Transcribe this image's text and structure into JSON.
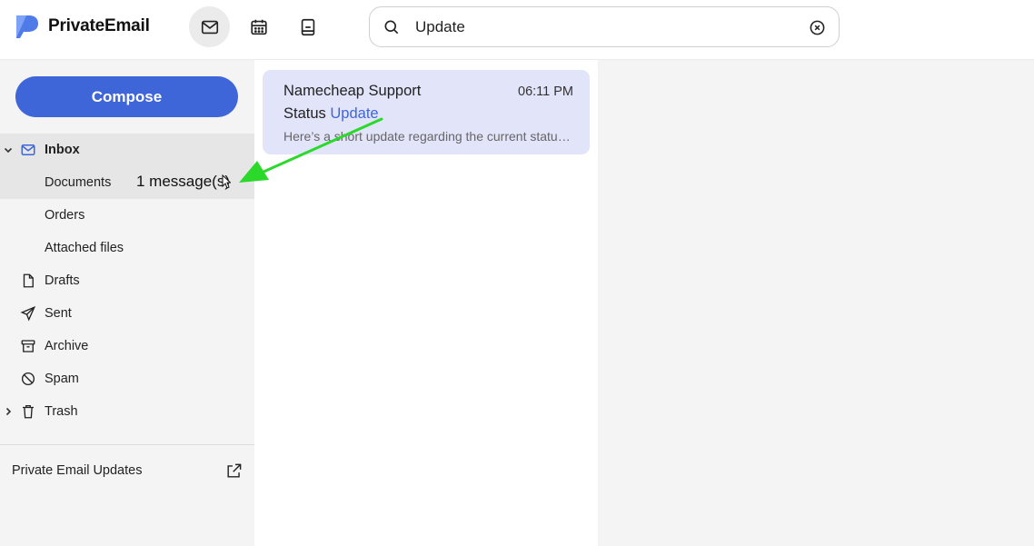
{
  "app": {
    "name": "PrivateEmail",
    "brand_color": "#3f66d8"
  },
  "header": {
    "nav": [
      {
        "name": "mail",
        "icon": "mail-icon",
        "active": true
      },
      {
        "name": "calendar",
        "icon": "calendar-icon",
        "active": false
      },
      {
        "name": "contacts",
        "icon": "address-book-icon",
        "active": false
      }
    ],
    "search": {
      "value": "Update",
      "placeholder": ""
    }
  },
  "sidebar": {
    "compose_label": "Compose",
    "folders": [
      {
        "label": "Inbox",
        "icon": "mail-icon",
        "expanded": true
      },
      {
        "label": "Documents",
        "selected": true
      },
      {
        "label": "Orders"
      },
      {
        "label": "Attached files"
      },
      {
        "label": "Drafts",
        "icon": "file-icon"
      },
      {
        "label": "Sent",
        "icon": "send-icon"
      },
      {
        "label": "Archive",
        "icon": "archive-icon"
      },
      {
        "label": "Spam",
        "icon": "ban-icon"
      },
      {
        "label": "Trash",
        "icon": "trash-icon",
        "expanded": false
      }
    ],
    "drag_tooltip": "1 message(s)",
    "updates_label": "Private Email Updates"
  },
  "list": {
    "messages": [
      {
        "sender": "Namecheap Support",
        "time": "06:11 PM",
        "subject_prefix": "Status ",
        "subject_highlight": "Update",
        "preview": "Here’s a short update regarding the current status of your request"
      }
    ]
  },
  "colors": {
    "selected_card": "#e2e4fa",
    "annotation_arrow": "#2bd92b"
  }
}
